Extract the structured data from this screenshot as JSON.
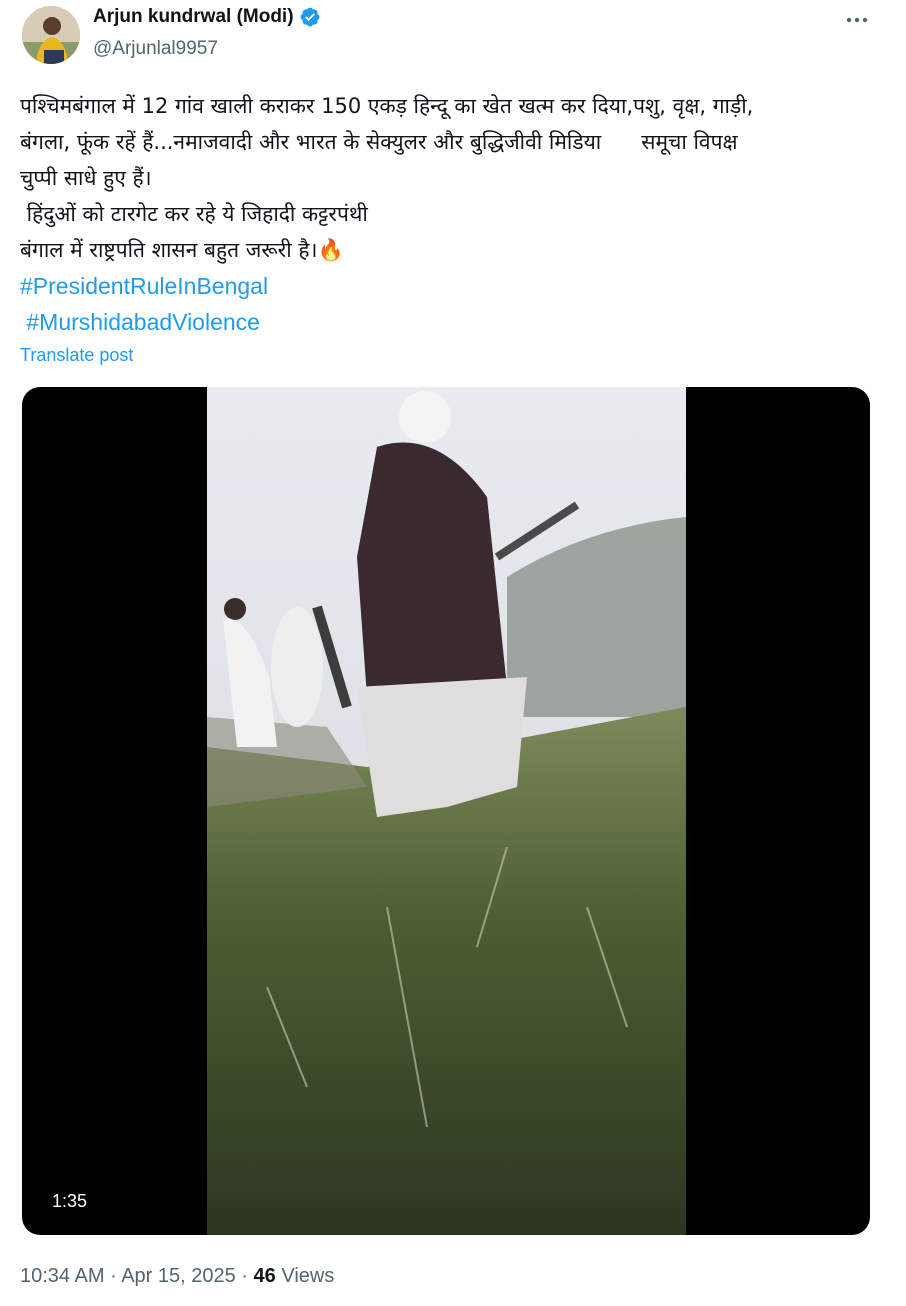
{
  "author": {
    "display_name": "Arjun kundrwal (Modi)",
    "handle": "@Arjunlal9957",
    "verified_color": "#1d9bf0"
  },
  "post": {
    "lines": [
      "पश्चिमबंगाल में 12 गांव खाली कराकर 150 एकड़ हिन्दू का खेत खत्म कर दिया,पशु, वृक्ष, गाड़ी,",
      "बंगला, फूंक रहें हैं...नमाजवादी और भारत के सेक्युलर और बुद्धिजीवी मिडिया      समूचा विपक्ष",
      "चुप्पी साधे हुए हैं।",
      " हिंदुओं को टारगेट कर रहे ये जिहादी कट्टरपंथी",
      "बंगाल में राष्ट्रपति शासन बहुत जरूरी है।🔥"
    ],
    "hashtags": [
      "#PresidentRuleInBengal",
      " #MurshidabadViolence"
    ],
    "translate_label": "Translate post"
  },
  "video": {
    "duration": "1:35"
  },
  "meta": {
    "time": "10:34 AM",
    "separator": "·",
    "date": "Apr 15, 2025",
    "views_count": "46",
    "views_label": "Views"
  },
  "colors": {
    "link": "#1d9bf0",
    "secondary_text": "#536471",
    "primary_text": "#0f1419"
  }
}
